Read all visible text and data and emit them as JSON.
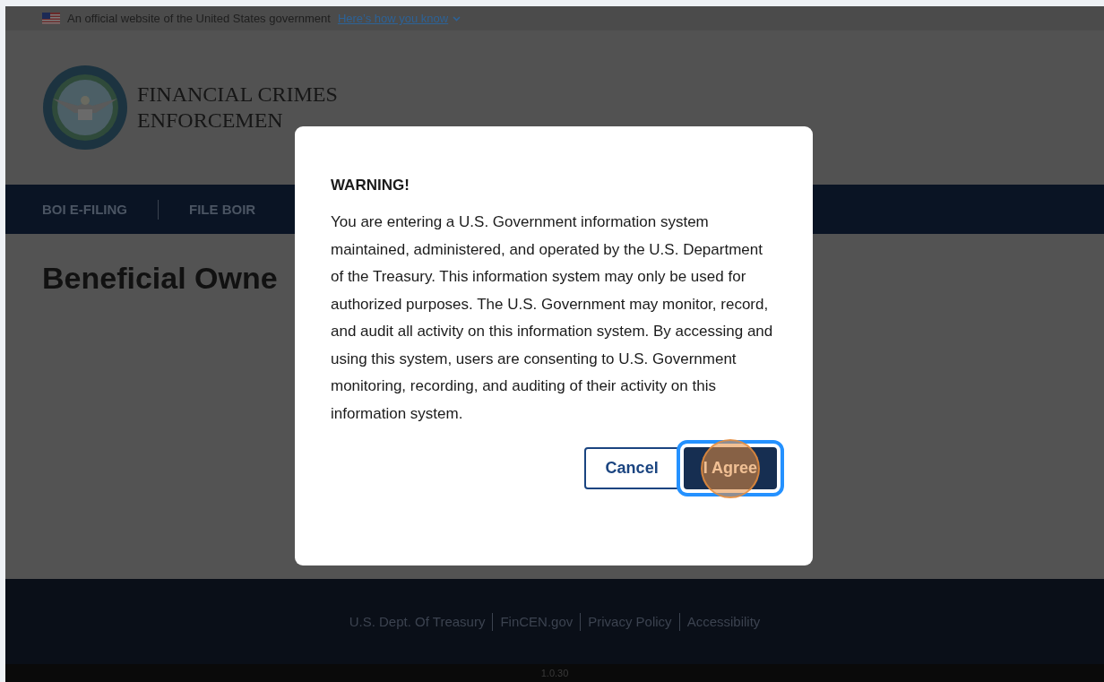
{
  "gov_banner": {
    "text": "An official website of the United States government",
    "link": "Here’s how you know"
  },
  "header": {
    "title_lines": [
      "FINANCIAL CRIMES",
      "ENFORCEMEN"
    ]
  },
  "nav": {
    "items": [
      {
        "label": "BOI E-FILING"
      },
      {
        "label": "FILE BOIR"
      }
    ]
  },
  "main": {
    "heading": "Beneficial Owne"
  },
  "footer": {
    "links": [
      "U.S. Dept. Of Treasury",
      "FinCEN.gov",
      "Privacy Policy",
      "Accessibility"
    ],
    "version": "1.0.30"
  },
  "modal": {
    "title": "WARNING!",
    "body": "You are entering a U.S. Government information system maintained, administered, and operated by the U.S. Department of the Treasury. This information system may only be used for authorized purposes. The U.S. Government may monitor, record, and audit all activity on this information system. By accessing and using this system, users are consenting to U.S. Government monitoring, recording, and auditing of their activity on this information system.",
    "buttons": [
      {
        "label": "Cancel",
        "kind": "outline",
        "focused": false
      },
      {
        "label": "I Agree",
        "kind": "primary",
        "focused": true
      }
    ]
  }
}
